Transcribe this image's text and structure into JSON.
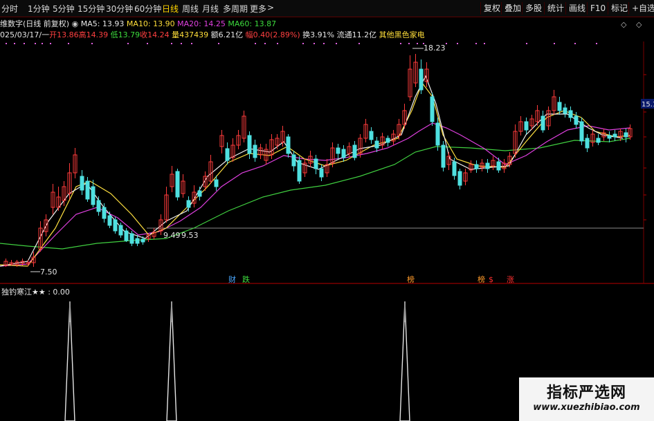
{
  "toolbar": {
    "timeframes": [
      "分时",
      "1分钟",
      "5分钟",
      "15分钟",
      "30分钟",
      "60分钟",
      "日线",
      "周线",
      "月线",
      "多周期",
      "更多"
    ],
    "active_timeframe": "日线",
    "more_arrow": ">",
    "right_buttons": [
      "复权",
      "叠加",
      "多股",
      "统计",
      "画线",
      "F10",
      "标记",
      "+自选"
    ]
  },
  "info_line": {
    "title": "维数字(日线 前复权)",
    "ma5": "MA5: 13.93",
    "ma10": "MA10: 13.90",
    "ma20": "MA20: 14.25",
    "ma60": "MA60: 13.87"
  },
  "quote_line": {
    "date": "025/03/17/一",
    "open": "开13.86",
    "high": "高14.39",
    "low": "低13.79",
    "close": "收14.24",
    "volume": "量437439",
    "amount": "额6.21亿",
    "change": "幅0.40(2.89%)",
    "turnover": "换3.91%",
    "float_cap": "流通11.2亿",
    "sector": "其他黑色家电"
  },
  "chart_labels": {
    "high_mark": "18.23",
    "low_mark": "7.50",
    "mid_left": "9.49",
    "mid_right": "9.53",
    "right_price": "15.1"
  },
  "event_markers": [
    {
      "text": "财",
      "color": "#4aa8ff"
    },
    {
      "text": "跌",
      "color": "#3ddc3d"
    },
    {
      "text": "榜",
      "color": "#ff9a2a"
    },
    {
      "text": "榜",
      "color": "#ff9a2a"
    },
    {
      "text": "$",
      "color": "#ff3030"
    },
    {
      "text": "涨",
      "color": "#ff3030"
    }
  ],
  "indicator": {
    "label": "独钓寒江★★ : 0.00"
  },
  "watermark": {
    "title": "指标严选网",
    "url": "www.xuezhibiao.com"
  },
  "chart_data": {
    "type": "candlestick",
    "indicator_type": "spike",
    "indicator_spikes": 3,
    "price_extremes": {
      "high": 18.23,
      "low": 7.5
    },
    "moving_averages": [
      "MA5",
      "MA10",
      "MA20",
      "MA60"
    ],
    "colors": {
      "up": "#ff3b3b",
      "down": "#4fe0e0",
      "ma5": "#f0f0f0",
      "ma10": "#ffe040",
      "ma20": "#e040e0",
      "ma60": "#40d040"
    }
  }
}
